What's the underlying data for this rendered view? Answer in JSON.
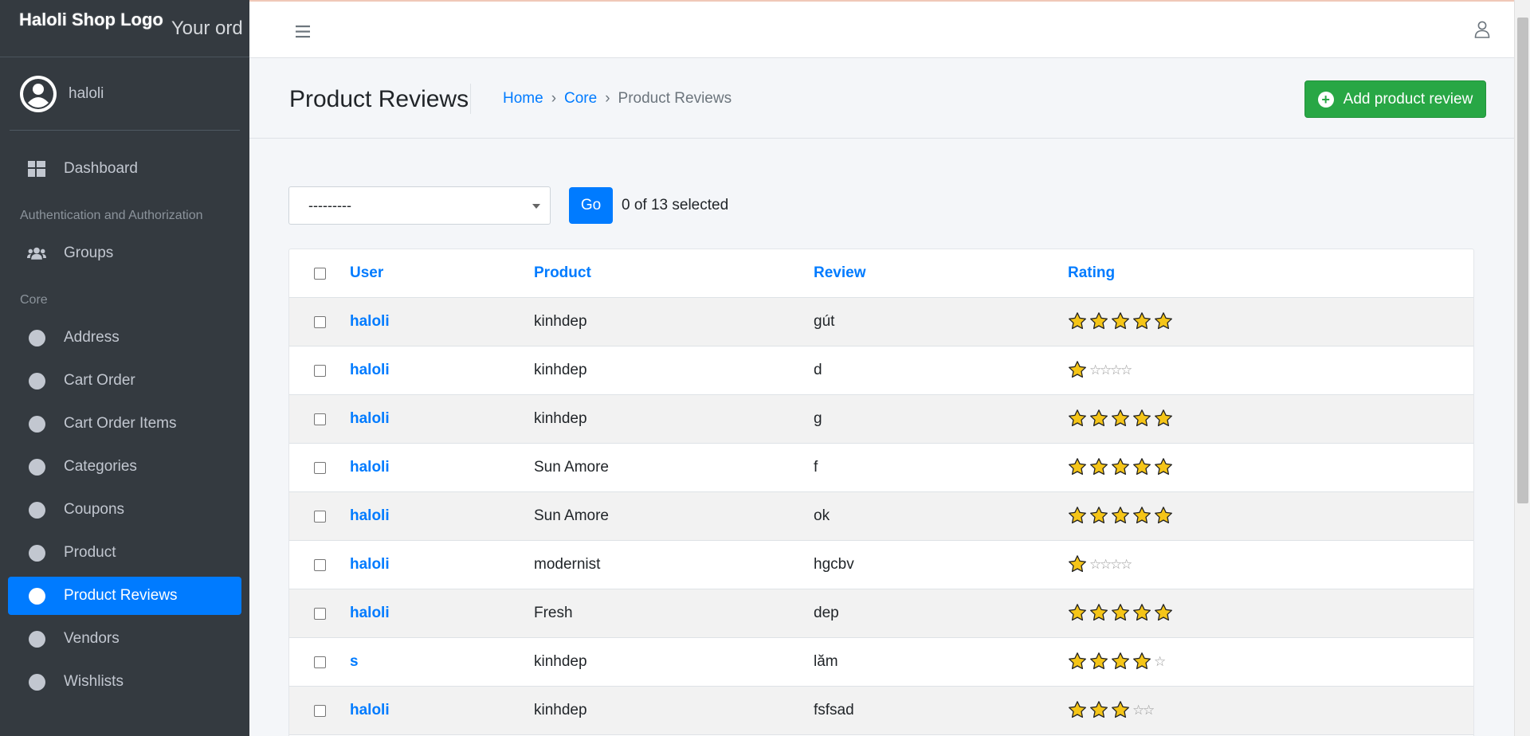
{
  "brand": {
    "logo_alt": "Haloli Shop Logo",
    "text": "Your ord"
  },
  "user": {
    "name": "haloli"
  },
  "sidebar": {
    "dashboard": "Dashboard",
    "auth_header": "Authentication and Authorization",
    "groups": "Groups",
    "core_header": "Core",
    "items": [
      "Address",
      "Cart Order",
      "Cart Order Items",
      "Categories",
      "Coupons",
      "Product",
      "Product Reviews",
      "Vendors",
      "Wishlists"
    ],
    "active": "Product Reviews"
  },
  "header": {
    "title": "Product Reviews",
    "breadcrumb": [
      "Home",
      "Core",
      "Product Reviews"
    ],
    "breadcrumb_sep": "›",
    "add_button": "Add product review"
  },
  "actions": {
    "select_value": "---------",
    "go_label": "Go",
    "selected_text": "0 of 13 selected"
  },
  "table": {
    "columns": [
      "User",
      "Product",
      "Review",
      "Rating"
    ],
    "rows": [
      {
        "user": "haloli",
        "product": "kinhdep",
        "review": "gút",
        "rating": 5
      },
      {
        "user": "haloli",
        "product": "kinhdep",
        "review": "d",
        "rating": 1
      },
      {
        "user": "haloli",
        "product": "kinhdep",
        "review": "g",
        "rating": 5
      },
      {
        "user": "haloli",
        "product": "Sun Amore",
        "review": "f",
        "rating": 5
      },
      {
        "user": "haloli",
        "product": "Sun Amore",
        "review": "ok",
        "rating": 5
      },
      {
        "user": "haloli",
        "product": "modernist",
        "review": "hgcbv",
        "rating": 1
      },
      {
        "user": "haloli",
        "product": "Fresh",
        "review": "dep",
        "rating": 5
      },
      {
        "user": "s",
        "product": "kinhdep",
        "review": "lăm",
        "rating": 4
      },
      {
        "user": "haloli",
        "product": "kinhdep",
        "review": "fsfsad",
        "rating": 3
      }
    ]
  },
  "colors": {
    "primary": "#007bff",
    "success": "#28a745",
    "sidebar": "#343a40",
    "star": "#f5c518"
  }
}
